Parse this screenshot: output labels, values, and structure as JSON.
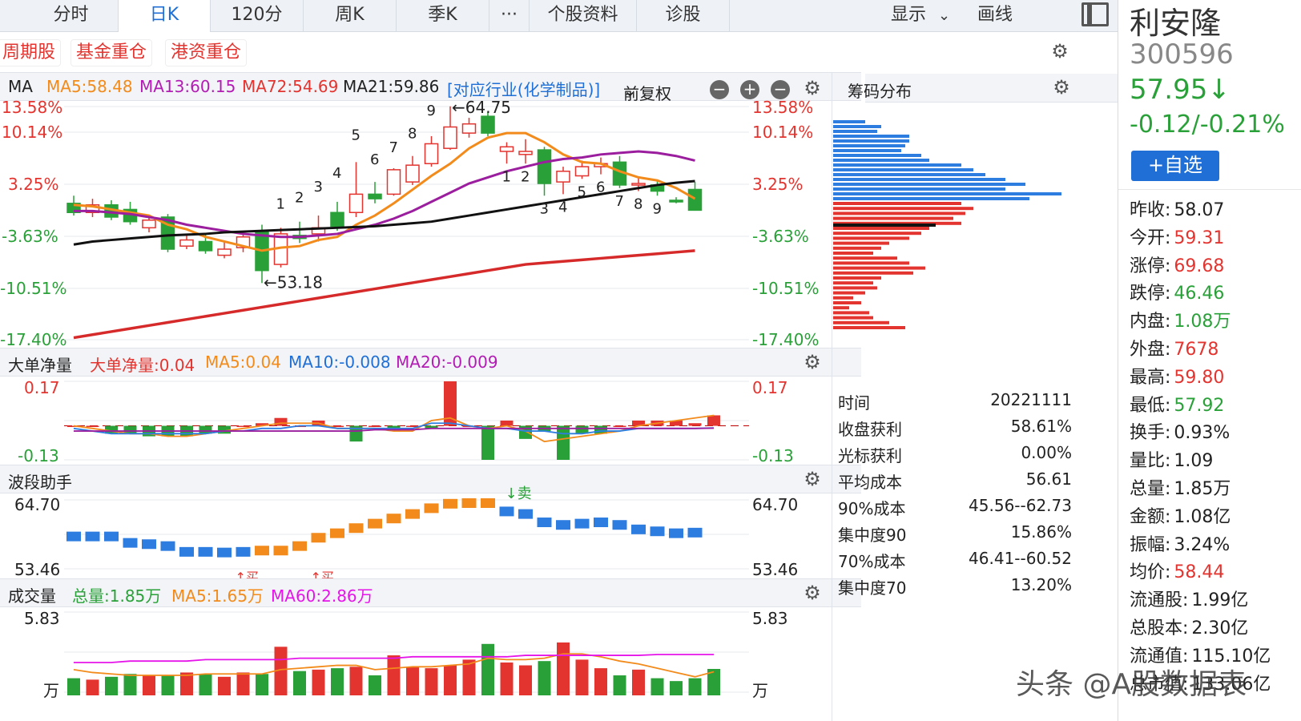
{
  "tabs": [
    "分时",
    "日K",
    "120分",
    "周K",
    "季K",
    "个股资料",
    "诊股"
  ],
  "more_label": "···",
  "toolbar": {
    "display_label": "显示",
    "draw_label": "画线"
  },
  "tags": [
    "周期股",
    "基金重仓",
    "港资重仓"
  ],
  "ma_header": {
    "name": "MA",
    "ma5": "MA5:58.48",
    "ma13": "MA13:60.15",
    "ma72": "MA72:54.69",
    "ma21": "MA21:59.86",
    "industry": "[对应行业(化学制品)]",
    "adjust": "前复权"
  },
  "main_axis": [
    "13.58%",
    "10.14%",
    "3.25%",
    "-3.63%",
    "-10.51%",
    "-17.40%"
  ],
  "main_labels": {
    "high": "←64.75",
    "low": "←53.18"
  },
  "td_up": [
    "1",
    "2",
    "3",
    "4",
    "5",
    "6",
    "7",
    "8",
    "9"
  ],
  "td_down": [
    "1",
    "2",
    "3",
    "4",
    "5",
    "6",
    "7",
    "8",
    "9"
  ],
  "flow_header": {
    "name": "大单净量",
    "value": "大单净量:0.04",
    "ma5": "MA5:0.04",
    "ma10": "MA10:-0.008",
    "ma20": "MA20:-0.009"
  },
  "flow_axis": [
    "0.17",
    "-0.13"
  ],
  "wave_header": {
    "name": "波段助手"
  },
  "wave_axis": [
    "64.70",
    "53.46"
  ],
  "wave_marks": {
    "sell": "↓卖",
    "buy": "↑买"
  },
  "volume_header": {
    "name": "成交量",
    "total": "总量:1.85万",
    "ma5": "MA5:1.65万",
    "ma60": "MA60:2.86万"
  },
  "volume_axis": {
    "top": "5.83",
    "unit": "万"
  },
  "chips": {
    "title": "筹码分布",
    "stats": [
      {
        "k": "时间",
        "v": "20221111"
      },
      {
        "k": "收盘获利",
        "v": "58.61%"
      },
      {
        "k": "光标获利",
        "v": "0.00%"
      },
      {
        "k": "平均成本",
        "v": "56.61"
      },
      {
        "k": "90%成本",
        "v": "45.56--62.73"
      },
      {
        "k": "集中度90",
        "v": "15.86%"
      },
      {
        "k": "70%成本",
        "v": "46.41--60.52"
      },
      {
        "k": "集中度70",
        "v": "13.20%"
      }
    ]
  },
  "stock": {
    "name": "利安隆",
    "code": "300596",
    "price": "57.95↓",
    "change": "-0.12/-0.21%",
    "add_label": "+自选",
    "info": [
      {
        "k": "昨收:",
        "v": "58.07"
      },
      {
        "k": "今开:",
        "v": "59.31"
      },
      {
        "k": "涨停:",
        "v": "69.68"
      },
      {
        "k": "跌停:",
        "v": "46.46"
      },
      {
        "k": "内盘:",
        "v": "1.08万"
      },
      {
        "k": "外盘:",
        "v": "7678"
      },
      {
        "k": "最高:",
        "v": "59.80"
      },
      {
        "k": "最低:",
        "v": "57.92"
      },
      {
        "k": "换手:",
        "v": "0.93%"
      },
      {
        "k": "量比:",
        "v": "1.09"
      },
      {
        "k": "总量:",
        "v": "1.85万"
      },
      {
        "k": "金额:",
        "v": "1.08亿"
      },
      {
        "k": "振幅:",
        "v": "3.24%"
      },
      {
        "k": "均价:",
        "v": "58.44"
      },
      {
        "k": "流通股:",
        "v": "1.99亿"
      },
      {
        "k": "总股本:",
        "v": "2.30亿"
      },
      {
        "k": "流通值:",
        "v": "115.10亿"
      },
      {
        "k": "总市值:",
        "v": "133.06亿"
      }
    ]
  },
  "watermark": "头条 @A股数据表",
  "colors": {
    "up": "#e3342f",
    "down": "#2aa039",
    "accent": "#1f6fd6",
    "ma5": "#f28b1b",
    "ma13": "#9b1e9e",
    "ma72": "#d62a2a",
    "ma21": "#111111"
  },
  "chart_data": [
    {
      "type": "candlestick",
      "title": "日K",
      "ylim": [
        53.18,
        64.75
      ],
      "candles": [
        {
          "o": 58.4,
          "h": 58.9,
          "l": 57.6,
          "c": 57.8
        },
        {
          "o": 57.8,
          "h": 58.7,
          "l": 57.5,
          "c": 58.3
        },
        {
          "o": 58.3,
          "h": 58.6,
          "l": 57.3,
          "c": 57.5
        },
        {
          "o": 58.0,
          "h": 58.5,
          "l": 57.0,
          "c": 57.2
        },
        {
          "o": 56.8,
          "h": 57.6,
          "l": 56.5,
          "c": 57.3
        },
        {
          "o": 57.5,
          "h": 57.7,
          "l": 55.2,
          "c": 55.4
        },
        {
          "o": 55.6,
          "h": 56.3,
          "l": 55.4,
          "c": 56.0
        },
        {
          "o": 55.9,
          "h": 56.4,
          "l": 55.1,
          "c": 55.3
        },
        {
          "o": 55.0,
          "h": 55.9,
          "l": 54.8,
          "c": 55.4
        },
        {
          "o": 55.5,
          "h": 56.5,
          "l": 55.2,
          "c": 56.2
        },
        {
          "o": 56.6,
          "h": 57.0,
          "l": 53.18,
          "c": 54.0
        },
        {
          "o": 54.4,
          "h": 56.8,
          "l": 54.2,
          "c": 56.4
        },
        {
          "o": 56.3,
          "h": 57.2,
          "l": 55.8,
          "c": 56.1
        },
        {
          "o": 56.4,
          "h": 57.6,
          "l": 55.9,
          "c": 56.8
        },
        {
          "o": 57.8,
          "h": 58.5,
          "l": 56.6,
          "c": 56.9
        },
        {
          "o": 57.8,
          "h": 61.1,
          "l": 57.5,
          "c": 59.0
        },
        {
          "o": 59.0,
          "h": 59.8,
          "l": 58.4,
          "c": 58.7
        },
        {
          "o": 59.0,
          "h": 60.7,
          "l": 58.9,
          "c": 60.6
        },
        {
          "o": 59.8,
          "h": 61.5,
          "l": 59.6,
          "c": 60.9
        },
        {
          "o": 61.0,
          "h": 62.8,
          "l": 60.8,
          "c": 62.3
        },
        {
          "o": 62.0,
          "h": 64.75,
          "l": 61.9,
          "c": 63.4
        },
        {
          "o": 63.0,
          "h": 64.0,
          "l": 62.7,
          "c": 63.6
        },
        {
          "o": 64.1,
          "h": 64.4,
          "l": 62.8,
          "c": 63.0
        },
        {
          "o": 61.8,
          "h": 62.4,
          "l": 61.0,
          "c": 62.1
        },
        {
          "o": 61.6,
          "h": 62.6,
          "l": 61.0,
          "c": 61.8
        },
        {
          "o": 61.9,
          "h": 62.1,
          "l": 58.9,
          "c": 59.7
        },
        {
          "o": 59.8,
          "h": 60.8,
          "l": 59.0,
          "c": 60.5
        },
        {
          "o": 60.2,
          "h": 61.2,
          "l": 60.0,
          "c": 60.8
        },
        {
          "o": 60.8,
          "h": 61.4,
          "l": 60.3,
          "c": 61.0
        },
        {
          "o": 61.1,
          "h": 61.5,
          "l": 59.4,
          "c": 59.6
        },
        {
          "o": 59.6,
          "h": 60.1,
          "l": 59.2,
          "c": 59.7
        },
        {
          "o": 59.6,
          "h": 59.9,
          "l": 58.9,
          "c": 59.2
        },
        {
          "o": 58.6,
          "h": 58.8,
          "l": 58.4,
          "c": 58.5
        },
        {
          "o": 59.31,
          "h": 59.8,
          "l": 57.92,
          "c": 57.95
        }
      ],
      "series": [
        {
          "name": "MA5",
          "values": [
            58.3,
            58.2,
            58.0,
            57.8,
            57.6,
            57.0,
            56.7,
            56.2,
            55.9,
            55.6,
            55.3,
            55.5,
            55.6,
            56.0,
            56.2,
            57.0,
            57.6,
            58.4,
            59.3,
            60.2,
            61.0,
            62.0,
            62.7,
            63.0,
            63.0,
            62.4,
            61.6,
            61.1,
            61.0,
            60.5,
            60.1,
            59.9,
            59.4,
            58.7
          ]
        },
        {
          "name": "MA13",
          "values": [
            57.9,
            57.9,
            57.8,
            57.7,
            57.5,
            57.3,
            57.0,
            56.8,
            56.6,
            56.4,
            56.3,
            56.2,
            56.2,
            56.3,
            56.4,
            56.7,
            57.0,
            57.4,
            57.9,
            58.5,
            59.1,
            59.7,
            60.1,
            60.5,
            60.8,
            61.1,
            61.3,
            61.4,
            61.6,
            61.7,
            61.8,
            61.7,
            61.5,
            61.2
          ]
        },
        {
          "name": "MA21",
          "values": [
            55.7,
            55.9,
            56.0,
            56.1,
            56.2,
            56.3,
            56.35,
            56.4,
            56.5,
            56.55,
            56.6,
            56.65,
            56.7,
            56.75,
            56.8,
            56.85,
            56.9,
            57.0,
            57.1,
            57.2,
            57.4,
            57.6,
            57.8,
            58.0,
            58.2,
            58.4,
            58.6,
            58.8,
            59.0,
            59.2,
            59.4,
            59.6,
            59.75,
            59.86
          ]
        },
        {
          "name": "MA72",
          "values": [
            49.6,
            49.8,
            50.0,
            50.2,
            50.4,
            50.6,
            50.8,
            51.0,
            51.2,
            51.4,
            51.6,
            51.8,
            52.0,
            52.2,
            52.4,
            52.6,
            52.8,
            53.0,
            53.2,
            53.4,
            53.6,
            53.8,
            54.0,
            54.2,
            54.4,
            54.5,
            54.6,
            54.7,
            54.8,
            54.9,
            55.0,
            55.1,
            55.2,
            55.3
          ]
        }
      ]
    },
    {
      "type": "bar",
      "title": "大单净量",
      "ylim": [
        -0.13,
        0.17
      ],
      "values": [
        0.0,
        0.0,
        -0.03,
        -0.03,
        -0.04,
        -0.04,
        -0.04,
        -0.03,
        -0.03,
        0.0,
        0.01,
        0.03,
        0.0,
        0.02,
        0.0,
        -0.06,
        0.0,
        -0.02,
        0.0,
        -0.01,
        0.17,
        0.0,
        -0.13,
        0.02,
        -0.05,
        -0.02,
        -0.13,
        -0.03,
        -0.03,
        0.0,
        0.02,
        0.02,
        0.02,
        0.01,
        0.04
      ],
      "series": [
        {
          "name": "MA5",
          "values": [
            0.0,
            -0.01,
            -0.02,
            -0.03,
            -0.03,
            -0.04,
            -0.04,
            -0.03,
            -0.02,
            -0.01,
            0.0,
            0.01,
            0.01,
            0.01,
            -0.01,
            -0.01,
            -0.01,
            -0.02,
            -0.02,
            0.02,
            0.03,
            0.0,
            -0.01,
            0.0,
            -0.02,
            -0.06,
            -0.05,
            -0.04,
            -0.03,
            -0.02,
            0.0,
            0.01,
            0.02,
            0.03,
            0.04
          ]
        },
        {
          "name": "MA10",
          "values": [
            -0.01,
            -0.02,
            -0.03,
            -0.03,
            -0.03,
            -0.03,
            -0.03,
            -0.03,
            -0.02,
            -0.02,
            -0.01,
            -0.01,
            0.0,
            0.0,
            -0.01,
            -0.01,
            -0.01,
            -0.01,
            -0.01,
            0.01,
            0.01,
            0.0,
            -0.01,
            -0.01,
            -0.02,
            -0.02,
            -0.03,
            -0.03,
            -0.02,
            -0.02,
            -0.01,
            -0.01,
            -0.01,
            -0.01,
            -0.008
          ]
        },
        {
          "name": "MA20",
          "values": [
            -0.02,
            -0.02,
            -0.02,
            -0.02,
            -0.02,
            -0.02,
            -0.02,
            -0.02,
            -0.02,
            -0.02,
            -0.02,
            -0.02,
            -0.02,
            -0.02,
            -0.02,
            -0.02,
            -0.015,
            -0.015,
            -0.015,
            -0.01,
            -0.01,
            -0.01,
            -0.01,
            -0.01,
            -0.01,
            -0.01,
            -0.01,
            -0.01,
            -0.01,
            -0.01,
            -0.01,
            -0.01,
            -0.01,
            -0.01,
            -0.009
          ]
        }
      ]
    },
    {
      "type": "bar",
      "title": "波段助手",
      "ylim": [
        53.46,
        64.7
      ],
      "values": [
        59.0,
        59.0,
        59.0,
        58.0,
        57.8,
        57.5,
        56.6,
        56.6,
        56.5,
        56.6,
        56.8,
        56.8,
        57.5,
        58.8,
        59.5,
        60.3,
        61.0,
        61.8,
        62.5,
        63.4,
        64.1,
        64.2,
        64.2,
        62.9,
        62.5,
        61.2,
        60.8,
        61.0,
        61.2,
        60.8,
        60.1,
        59.8,
        59.5,
        59.6
      ]
    },
    {
      "type": "bar",
      "title": "成交量",
      "ylim": [
        0,
        5.83
      ],
      "values": [
        1.2,
        1.1,
        1.3,
        1.5,
        1.4,
        1.4,
        1.6,
        1.5,
        1.3,
        1.6,
        1.5,
        3.4,
        1.7,
        1.8,
        1.9,
        2.0,
        1.4,
        2.8,
        2.0,
        1.9,
        2.1,
        2.5,
        3.6,
        2.3,
        2.1,
        2.4,
        3.7,
        2.5,
        1.9,
        1.4,
        1.8,
        1.2,
        1.0,
        1.2,
        1.85
      ],
      "series": [
        {
          "name": "MA5",
          "values": [
            1.8,
            1.6,
            1.5,
            1.4,
            1.4,
            1.4,
            1.4,
            1.5,
            1.5,
            1.5,
            1.5,
            1.8,
            1.9,
            2.0,
            2.1,
            2.1,
            1.8,
            1.9,
            2.0,
            2.0,
            2.1,
            2.2,
            2.6,
            2.5,
            2.5,
            2.6,
            2.9,
            2.9,
            2.7,
            2.4,
            2.2,
            1.9,
            1.6,
            1.3,
            1.65
          ]
        },
        {
          "name": "MA60",
          "values": [
            2.3,
            2.3,
            2.3,
            2.4,
            2.4,
            2.4,
            2.4,
            2.5,
            2.5,
            2.5,
            2.5,
            2.5,
            2.6,
            2.6,
            2.6,
            2.6,
            2.6,
            2.6,
            2.7,
            2.7,
            2.7,
            2.7,
            2.7,
            2.7,
            2.8,
            2.8,
            2.8,
            2.8,
            2.8,
            2.8,
            2.8,
            2.86,
            2.86,
            2.86,
            2.86
          ]
        }
      ]
    }
  ]
}
